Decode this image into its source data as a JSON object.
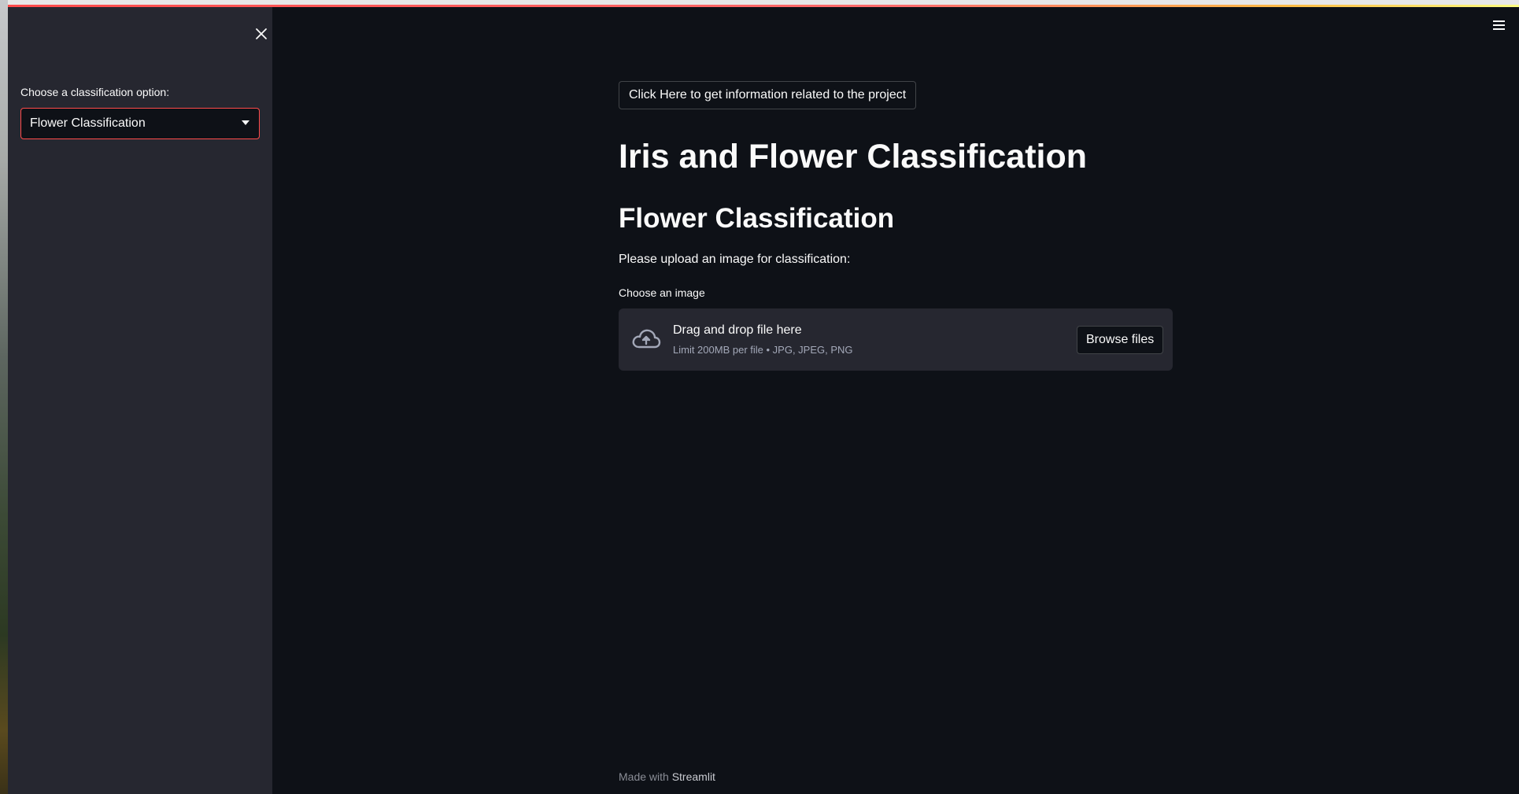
{
  "sidebar": {
    "close_icon": "close-icon",
    "select_label": "Choose a classification option:",
    "select_value": "Flower Classification"
  },
  "header": {
    "menu_icon": "hamburger-menu-icon"
  },
  "main": {
    "info_button": "Click Here to get information related to the project",
    "title": "Iris and Flower Classification",
    "subtitle": "Flower Classification",
    "upload_prompt": "Please upload an image for classification:",
    "uploader": {
      "label": "Choose an image",
      "drop_title": "Drag and drop file here",
      "drop_limits": "Limit 200MB per file • JPG, JPEG, PNG",
      "browse_button": "Browse files",
      "icon": "cloud-upload-icon"
    }
  },
  "footer": {
    "made_with": "Made with ",
    "brand": "Streamlit"
  },
  "colors": {
    "background": "#0e1117",
    "sidebar": "#262730",
    "accent": "#ff4b4b",
    "text": "#fafafa"
  }
}
